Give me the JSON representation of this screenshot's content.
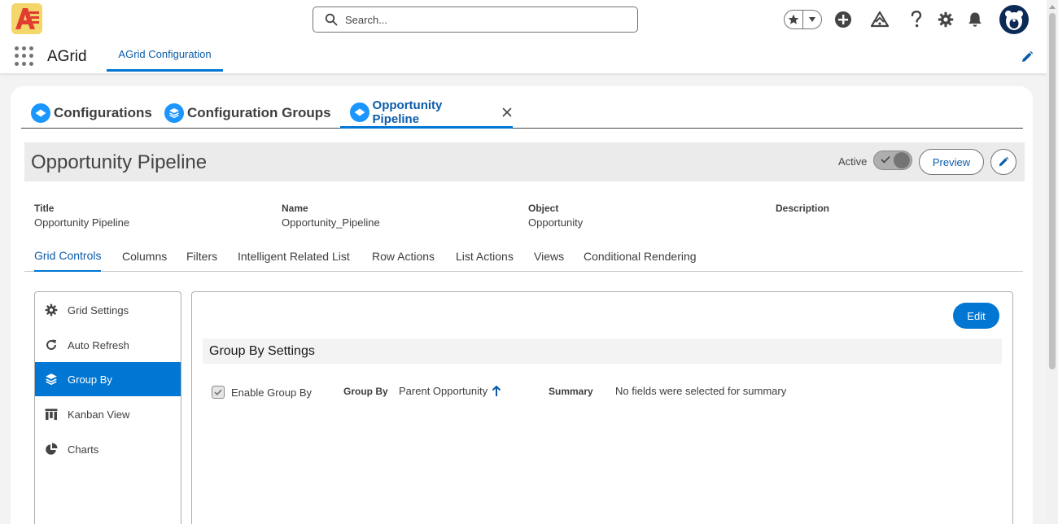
{
  "header": {
    "search_placeholder": "Search...",
    "icons": [
      "search-icon",
      "favorites-star-icon",
      "favorites-dropdown-icon",
      "add-icon",
      "trailhead-icon",
      "help-icon",
      "setup-gear-icon",
      "notification-bell-icon",
      "user-avatar"
    ]
  },
  "context_bar": {
    "app_name": "AGrid",
    "nav_tab": "AGrid Configuration"
  },
  "workspace_tabs": [
    {
      "label": "Configurations",
      "active": false
    },
    {
      "label": "Configuration Groups",
      "active": false
    },
    {
      "label": "Opportunity Pipeline",
      "active": true
    }
  ],
  "record": {
    "title": "Opportunity Pipeline",
    "status_label": "Active",
    "status_on": true,
    "preview_label": "Preview"
  },
  "fields": [
    {
      "label": "Title",
      "value": "Opportunity Pipeline"
    },
    {
      "label": "Name",
      "value": "Opportunity_Pipeline"
    },
    {
      "label": "Object",
      "value": "Opportunity"
    },
    {
      "label": "Description",
      "value": ""
    }
  ],
  "sub_tabs": [
    {
      "label": "Grid Controls",
      "active": true
    },
    {
      "label": "Columns",
      "active": false
    },
    {
      "label": "Filters",
      "active": false
    },
    {
      "label": "Intelligent Related List",
      "active": false
    },
    {
      "label": "Row Actions",
      "active": false
    },
    {
      "label": "List Actions",
      "active": false
    },
    {
      "label": "Views",
      "active": false
    },
    {
      "label": "Conditional Rendering",
      "active": false
    }
  ],
  "side_nav": [
    {
      "label": "Grid Settings",
      "icon": "gear-icon",
      "active": false
    },
    {
      "label": "Auto Refresh",
      "icon": "refresh-icon",
      "active": false
    },
    {
      "label": "Group By",
      "icon": "layers-icon",
      "active": true
    },
    {
      "label": "Kanban View",
      "icon": "kanban-icon",
      "active": false
    },
    {
      "label": "Charts",
      "icon": "pie-chart-icon",
      "active": false
    }
  ],
  "content": {
    "edit_label": "Edit",
    "section_title": "Group By Settings",
    "enable_label": "Enable Group By",
    "enable_checked": true,
    "group_by_label": "Group By",
    "group_by_value": "Parent Opportunity",
    "summary_label": "Summary",
    "summary_value": "No fields were selected for summary"
  },
  "colors": {
    "brand_blue": "#0176d3",
    "link_blue": "#0b5cab",
    "tab_icon_blue": "#1b96ff",
    "logo_yellow": "#f4d76a",
    "logo_red": "#e03c31"
  }
}
